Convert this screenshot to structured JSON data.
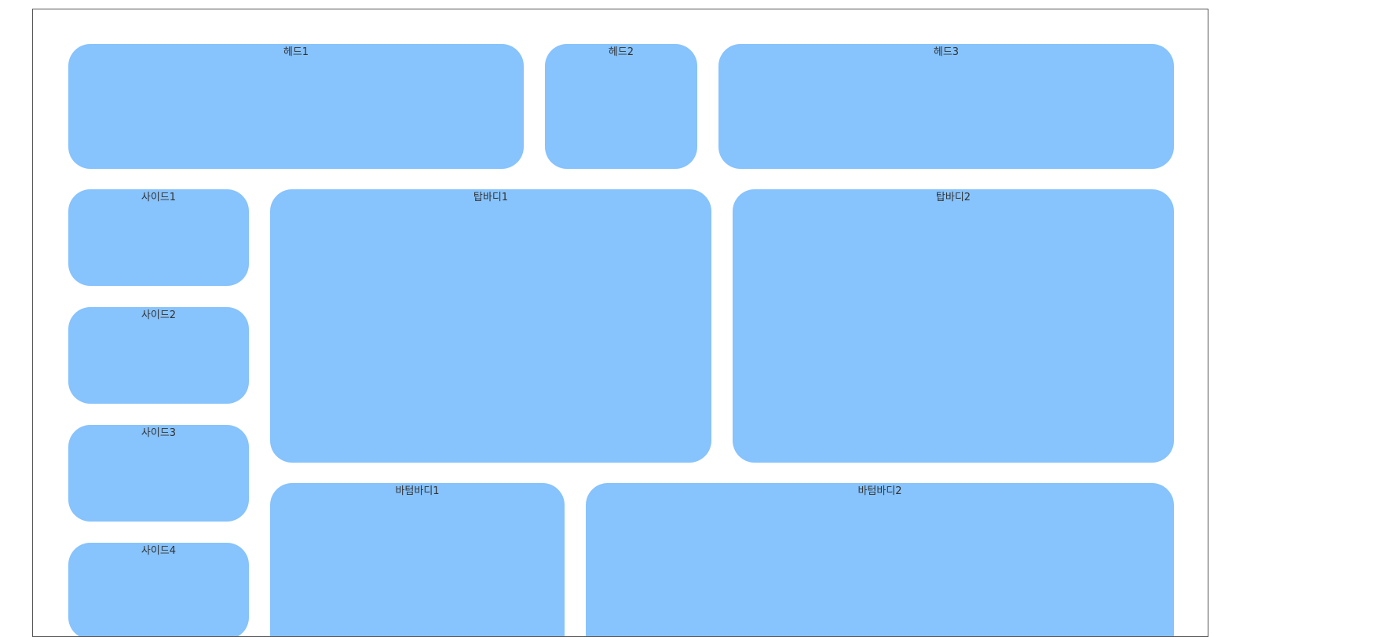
{
  "boxes": {
    "head1": "헤드1",
    "head2": "헤드2",
    "head3": "헤드3",
    "side1": "사이드1",
    "side2": "사이드2",
    "side3": "사이드3",
    "side4": "사이드4",
    "top_body1": "탑바디1",
    "top_body2": "탑바디2",
    "bottom_body1": "바텀바디1",
    "bottom_body2": "바텀바디2"
  },
  "colors": {
    "box_fill": "#87c3fc",
    "frame_border": "#555555",
    "label_text": "#333333"
  }
}
